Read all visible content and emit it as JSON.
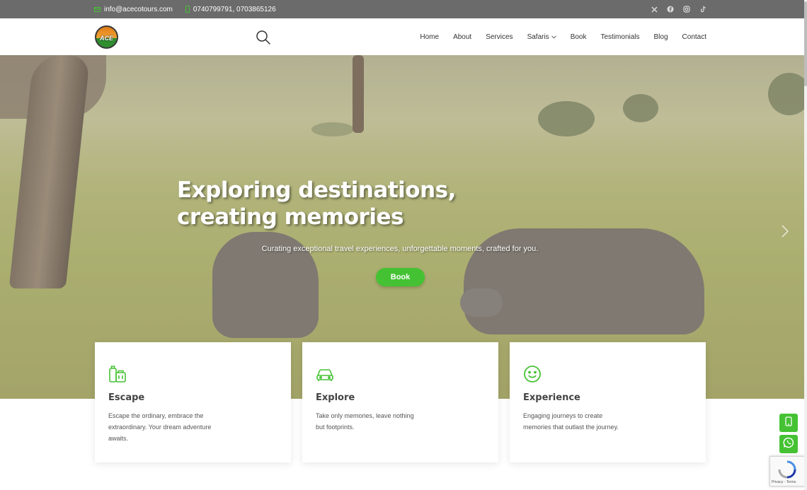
{
  "topbar": {
    "email": "info@acecotours.com",
    "phone": "0740799791, 0703865126",
    "social": [
      "x-icon",
      "facebook-icon",
      "instagram-icon",
      "tiktok-icon"
    ]
  },
  "header": {
    "logo_text": "ACE",
    "nav": [
      "Home",
      "About",
      "Services",
      "Safaris",
      "Book",
      "Testimonials",
      "Blog",
      "Contact"
    ]
  },
  "hero": {
    "title": "Exploring destinations, creating memories",
    "subtitle": "Curating exceptional travel experiences, unforgettable moments, crafted for you.",
    "button": "Book"
  },
  "cards": [
    {
      "icon": "luggage-icon",
      "title": "Escape",
      "text": "Escape the ordinary, embrace the extraordinary. Your dream adventure awaits."
    },
    {
      "icon": "car-icon",
      "title": "Explore",
      "text": "Take only memories, leave nothing but footprints."
    },
    {
      "icon": "smile-icon",
      "title": "Experience",
      "text": "Engaging journeys to create memories that outlast the journey."
    }
  ],
  "recaptcha": {
    "terms": "Privacy - Terms"
  },
  "colors": {
    "accent": "#45c233",
    "topbar": "#6b6b6b"
  }
}
